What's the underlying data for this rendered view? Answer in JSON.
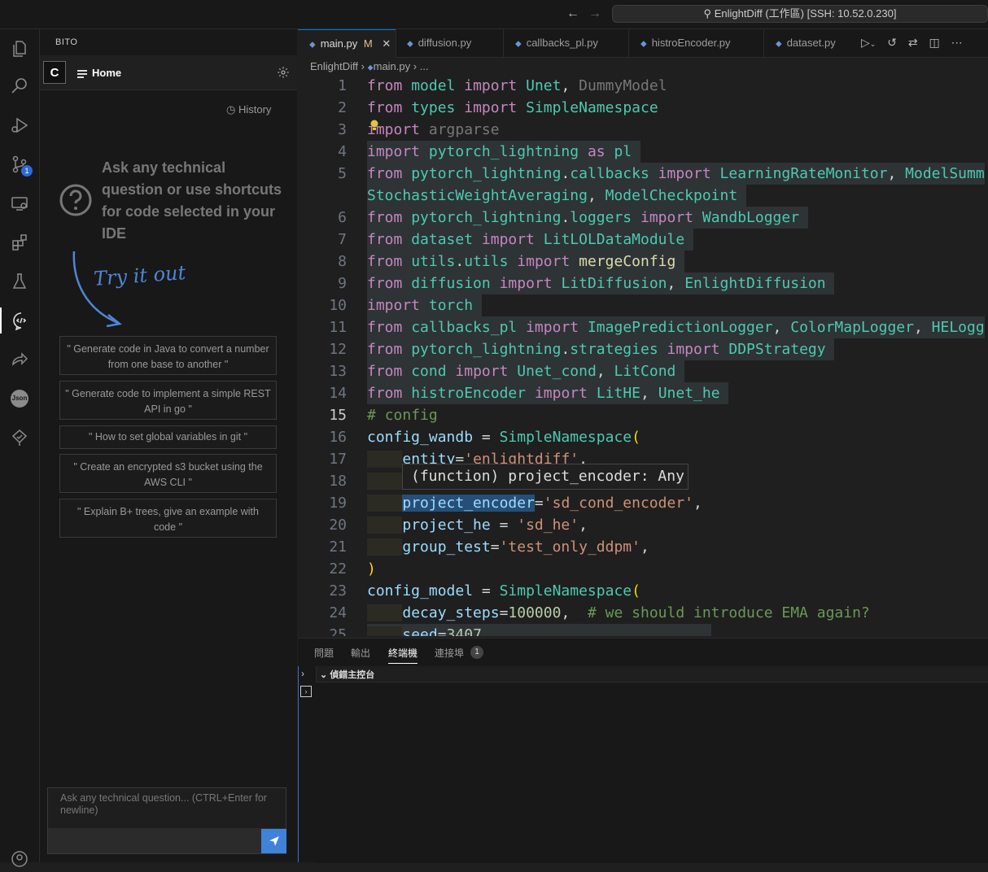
{
  "window": {
    "command_center": "EnlightDiff (工作區) [SSH: 10.52.0.230]"
  },
  "activity_bar": {
    "items": [
      "explorer-icon",
      "search-icon",
      "run-debug-icon",
      "source-control-icon",
      "remote-explorer-icon",
      "extensions-icon",
      "testing-icon",
      "bito-icon",
      "live-share-icon",
      "json-icon",
      "tree-check-icon",
      "account-icon"
    ],
    "scm_badge": "1",
    "json_label": "Json"
  },
  "bito": {
    "panel_title": "BITO",
    "logo_letter": "C",
    "home_tab": "Home",
    "history": "History",
    "prompt": "Ask any technical question or use shortcuts for code selected in your IDE",
    "try_it_out": "Try it out",
    "suggestions": [
      "\" Generate code in Java to convert a number from one base to another \"",
      "\" Generate code to implement a simple REST API in go \"",
      "\" How to set global variables in git \"",
      "\" Create an encrypted s3 bucket using the AWS CLI \"",
      "\" Explain B+ trees, give an example with code \""
    ],
    "input_placeholder": "Ask any technical question... (CTRL+Enter for newline)"
  },
  "editor": {
    "tabs": [
      {
        "label": "main.py",
        "status": "M",
        "active": true
      },
      {
        "label": "diffusion.py"
      },
      {
        "label": "callbacks_pl.py"
      },
      {
        "label": "histroEncoder.py"
      },
      {
        "label": "dataset.py"
      }
    ],
    "breadcrumb": [
      "EnlightDiff",
      "main.py",
      "..."
    ],
    "current_line": 15,
    "hover_tooltip": "(function) project_encoder: Any"
  },
  "code_lines": [
    {
      "n": "1",
      "t": "from model import Unet, DummyModel"
    },
    {
      "n": "2",
      "t": "from types import SimpleNamespace"
    },
    {
      "n": "3",
      "t": "import argparse"
    },
    {
      "n": "4",
      "t": "import pytorch_lightning as pl"
    },
    {
      "n": "5",
      "t": "from pytorch_lightning.callbacks import LearningRateMonitor, ModelSumm"
    },
    {
      "n": "",
      "t": "StochasticWeightAveraging, ModelCheckpoint"
    },
    {
      "n": "6",
      "t": "from pytorch_lightning.loggers import WandbLogger"
    },
    {
      "n": "7",
      "t": "from dataset import LitLOLDataModule"
    },
    {
      "n": "8",
      "t": "from utils.utils import mergeConfig"
    },
    {
      "n": "9",
      "t": "from diffusion import LitDiffusion, EnlightDiffusion"
    },
    {
      "n": "10",
      "t": "import torch"
    },
    {
      "n": "11",
      "t": "from callbacks_pl import ImagePredictionLogger, ColorMapLogger, HELogg"
    },
    {
      "n": "12",
      "t": "from pytorch_lightning.strategies import DDPStrategy"
    },
    {
      "n": "13",
      "t": "from cond import Unet_cond, LitCond"
    },
    {
      "n": "14",
      "t": "from histroEncoder import LitHE, Unet_he"
    },
    {
      "n": "15",
      "t": "# config"
    },
    {
      "n": "16",
      "t": "config_wandb = SimpleNamespace("
    },
    {
      "n": "17",
      "t": "    entity='enlightdiff',"
    },
    {
      "n": "18",
      "t": ""
    },
    {
      "n": "19",
      "t": "    project_encoder='sd_cond_encoder',"
    },
    {
      "n": "20",
      "t": "    project_he = 'sd_he',"
    },
    {
      "n": "21",
      "t": "    group_test='test_only_ddpm',"
    },
    {
      "n": "22",
      "t": ")"
    },
    {
      "n": "23",
      "t": "config_model = SimpleNamespace("
    },
    {
      "n": "24",
      "t": "    decay_steps=100000,  # we should introduce EMA again?"
    },
    {
      "n": "25",
      "t": "    seed=3407,"
    }
  ],
  "panel": {
    "tabs": [
      "問題",
      "輸出",
      "終端機",
      "連接埠"
    ],
    "active_tab": "終端機",
    "ports_badge": "1",
    "debug_console": "偵錯主控台"
  }
}
